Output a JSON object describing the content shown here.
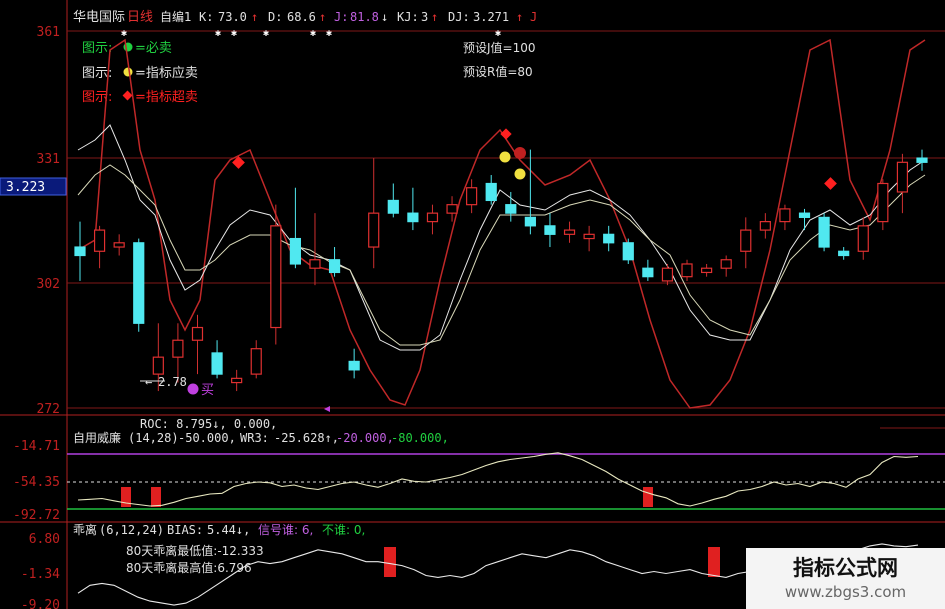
{
  "header": {
    "stock_name": "华电国际",
    "period": "日线",
    "formula": "自编1",
    "k_label": "K:",
    "k_value": "73.0",
    "k_arrow": "↑",
    "d_label": "D:",
    "d_value": "68.6",
    "d_arrow": "↑",
    "j_label": "J:",
    "j_value": "81.8",
    "j_arrow": "↓",
    "kj_label": "KJ:",
    "kj_value": "3",
    "kj_arrow": "↑",
    "dj_label": "DJ:",
    "dj_value": "3.271",
    "dj_arrow": "↑",
    "trailing": "J"
  },
  "legend": [
    {
      "prefix": "图示:",
      "text": "=必卖",
      "color": "#20d040"
    },
    {
      "prefix": "图示:",
      "text": "=指标应卖",
      "color": "#f0e040"
    },
    {
      "prefix": "图示:",
      "text": "=指标超卖",
      "color": "#ff2020"
    }
  ],
  "presets": {
    "j": "预设J值=100",
    "r": "预设R值=80"
  },
  "price_axis": {
    "ticks": [
      "361",
      "331",
      "302",
      "272"
    ],
    "current": "3.223"
  },
  "annotations": {
    "low_price": "2.78",
    "buy_label": "买"
  },
  "panel_williams": {
    "roc_line": "ROC: 8.795↓, 0.000,",
    "name": "自用威廉",
    "params": "(14,28)",
    "v1": "-50.000,",
    "wr3_label": "WR3:",
    "wr3_value": "-25.628↑,",
    "v3": "-20.000,",
    "v4": "-80.000,",
    "ticks": [
      "-14.71",
      "-54.35",
      "-92.72"
    ]
  },
  "panel_bias": {
    "name": "乖离",
    "params": "(6,12,24)",
    "bias_label": "BIAS:",
    "bias_value": "5.44↓,",
    "signal": "信号谁: 6,",
    "not_label": "不谁: 0,",
    "min_label": "80天乖离最低值:-12.333",
    "max_label": "80天乖离最高值:6.796",
    "ticks": [
      "6.80",
      "-1.34",
      "-9.20"
    ]
  },
  "chart_data": [
    {
      "type": "candlestick",
      "ylim": [
        272,
        361
      ],
      "ticks": [
        361,
        331,
        302,
        272
      ],
      "current_price_marker": 3.223,
      "low_annotation": 2.78,
      "candles": [
        {
          "o": 310,
          "h": 316,
          "l": 302,
          "c": 308
        },
        {
          "o": 309,
          "h": 315,
          "l": 305,
          "c": 314
        },
        {
          "o": 310,
          "h": 313,
          "l": 308,
          "c": 311
        },
        {
          "o": 311,
          "h": 312,
          "l": 290,
          "c": 292
        },
        {
          "o": 280,
          "h": 292,
          "l": 276,
          "c": 284
        },
        {
          "o": 284,
          "h": 292,
          "l": 278,
          "c": 288
        },
        {
          "o": 288,
          "h": 294,
          "l": 280,
          "c": 291
        },
        {
          "o": 285,
          "h": 288,
          "l": 279,
          "c": 280
        },
        {
          "o": 278,
          "h": 281,
          "l": 276,
          "c": 279
        },
        {
          "o": 280,
          "h": 288,
          "l": 279,
          "c": 286
        },
        {
          "o": 291,
          "h": 320,
          "l": 287,
          "c": 315
        },
        {
          "o": 312,
          "h": 324,
          "l": 305,
          "c": 306
        },
        {
          "o": 305,
          "h": 318,
          "l": 301,
          "c": 307
        },
        {
          "o": 307,
          "h": 310,
          "l": 303,
          "c": 304
        },
        {
          "o": 283,
          "h": 286,
          "l": 279,
          "c": 281
        },
        {
          "o": 310,
          "h": 331,
          "l": 305,
          "c": 318
        },
        {
          "o": 321,
          "h": 325,
          "l": 317,
          "c": 318
        },
        {
          "o": 318,
          "h": 324,
          "l": 314,
          "c": 316
        },
        {
          "o": 316,
          "h": 320,
          "l": 313,
          "c": 318
        },
        {
          "o": 318,
          "h": 322,
          "l": 316,
          "c": 320
        },
        {
          "o": 320,
          "h": 326,
          "l": 318,
          "c": 324
        },
        {
          "o": 325,
          "h": 327,
          "l": 320,
          "c": 321
        },
        {
          "o": 320,
          "h": 323,
          "l": 316,
          "c": 318
        },
        {
          "o": 317,
          "h": 333,
          "l": 313,
          "c": 315
        },
        {
          "o": 315,
          "h": 318,
          "l": 310,
          "c": 313
        },
        {
          "o": 313,
          "h": 316,
          "l": 311,
          "c": 314
        },
        {
          "o": 312,
          "h": 315,
          "l": 309,
          "c": 313
        },
        {
          "o": 313,
          "h": 315,
          "l": 309,
          "c": 311
        },
        {
          "o": 311,
          "h": 312,
          "l": 306,
          "c": 307
        },
        {
          "o": 305,
          "h": 307,
          "l": 302,
          "c": 303
        },
        {
          "o": 302,
          "h": 306,
          "l": 301,
          "c": 305
        },
        {
          "o": 303,
          "h": 307,
          "l": 302,
          "c": 306
        },
        {
          "o": 304,
          "h": 306,
          "l": 303,
          "c": 305
        },
        {
          "o": 305,
          "h": 308,
          "l": 303,
          "c": 307
        },
        {
          "o": 309,
          "h": 317,
          "l": 305,
          "c": 314
        },
        {
          "o": 314,
          "h": 318,
          "l": 312,
          "c": 316
        },
        {
          "o": 316,
          "h": 320,
          "l": 314,
          "c": 319
        },
        {
          "o": 318,
          "h": 319,
          "l": 314,
          "c": 317
        },
        {
          "o": 317,
          "h": 318,
          "l": 309,
          "c": 310
        },
        {
          "o": 309,
          "h": 310,
          "l": 307,
          "c": 308
        },
        {
          "o": 309,
          "h": 317,
          "l": 307,
          "c": 315
        },
        {
          "o": 316,
          "h": 326,
          "l": 314,
          "c": 325
        },
        {
          "o": 323,
          "h": 332,
          "l": 318,
          "c": 330
        },
        {
          "o": 331,
          "h": 333,
          "l": 328,
          "c": 330
        }
      ]
    },
    {
      "type": "line",
      "name": "自用威廉",
      "ylim": [
        -100,
        0
      ],
      "ticks": [
        -14.71,
        -54.35,
        -92.72
      ],
      "reference_levels": [
        -20,
        -50,
        -80
      ],
      "x": [
        0,
        1,
        2,
        3,
        4,
        5,
        6,
        7,
        8,
        9,
        10,
        11,
        12,
        13,
        14,
        15,
        16,
        17,
        18,
        19,
        20,
        21,
        22,
        23,
        24,
        25,
        26,
        27,
        28,
        29,
        30,
        31,
        32,
        33,
        34,
        35,
        36,
        37,
        38,
        39,
        40,
        41,
        42,
        43,
        44,
        45,
        46,
        47,
        48,
        49,
        50,
        51,
        52,
        53,
        54,
        55,
        56,
        57,
        58,
        59,
        60,
        61,
        62,
        63,
        64,
        65,
        66,
        67,
        68,
        69,
        70
      ],
      "values": [
        -80,
        -79,
        -78,
        -81,
        -84,
        -86,
        -88,
        -87,
        -83,
        -78,
        -75,
        -72,
        -71,
        -62,
        -58,
        -56,
        -57,
        -62,
        -60,
        -64,
        -66,
        -62,
        -58,
        -56,
        -60,
        -63,
        -58,
        -52,
        -55,
        -56,
        -53,
        -50,
        -46,
        -40,
        -34,
        -29,
        -26,
        -24,
        -22,
        -19,
        -17,
        -21,
        -26,
        -34,
        -42,
        -52,
        -60,
        -68,
        -73,
        -77,
        -85,
        -88,
        -84,
        -79,
        -75,
        -68,
        -66,
        -62,
        -56,
        -60,
        -58,
        -62,
        -56,
        -58,
        -63,
        -52,
        -46,
        -30,
        -22,
        -23,
        -22
      ],
      "signal_bars": [
        {
          "x": 4
        },
        {
          "x": 6.5
        },
        {
          "x": 47.5
        }
      ]
    },
    {
      "type": "line",
      "name": "乖离",
      "ylim": [
        -10,
        8
      ],
      "ticks": [
        6.8,
        -1.34,
        -9.2
      ],
      "x": [
        0,
        1,
        2,
        3,
        4,
        5,
        6,
        7,
        8,
        9,
        10,
        11,
        12,
        13,
        14,
        15,
        16,
        17,
        18,
        19,
        20,
        21,
        22,
        23,
        24,
        25,
        26,
        27,
        28,
        29,
        30,
        31,
        32,
        33,
        34,
        35,
        36,
        37,
        38,
        39,
        40,
        41,
        42,
        43,
        44,
        45,
        46,
        47,
        48,
        49,
        50,
        51,
        52,
        53,
        54,
        55,
        56,
        57,
        58,
        59,
        60,
        61,
        62,
        63,
        64,
        65,
        66,
        67,
        68,
        69,
        70
      ],
      "values": [
        -6,
        -4,
        -3.5,
        -4,
        -5.5,
        -7,
        -8,
        -8.5,
        -9,
        -8.5,
        -7,
        -5,
        -3,
        -1,
        1,
        2,
        1.5,
        2,
        3,
        4,
        5,
        4.5,
        4,
        3,
        2,
        2,
        1.5,
        1,
        0,
        -1.5,
        -2,
        -1.5,
        -2,
        -1,
        1,
        2,
        3,
        4,
        3.5,
        3,
        4,
        5,
        4.5,
        3.5,
        2,
        1,
        0,
        -1,
        -0.5,
        -1,
        -0.5,
        0,
        -1,
        -1.5,
        -2,
        -1,
        -0.5,
        0,
        1,
        0.5,
        1.5,
        2,
        1,
        2,
        3,
        5,
        6,
        6.5,
        6,
        5.8,
        6.2
      ],
      "min_80d": -12.333,
      "max_80d": 6.796,
      "signal_bars": [
        {
          "x": 26
        },
        {
          "x": 53
        }
      ]
    }
  ],
  "watermark": {
    "title": "指标公式网",
    "url": "www.zbgs3.com"
  }
}
